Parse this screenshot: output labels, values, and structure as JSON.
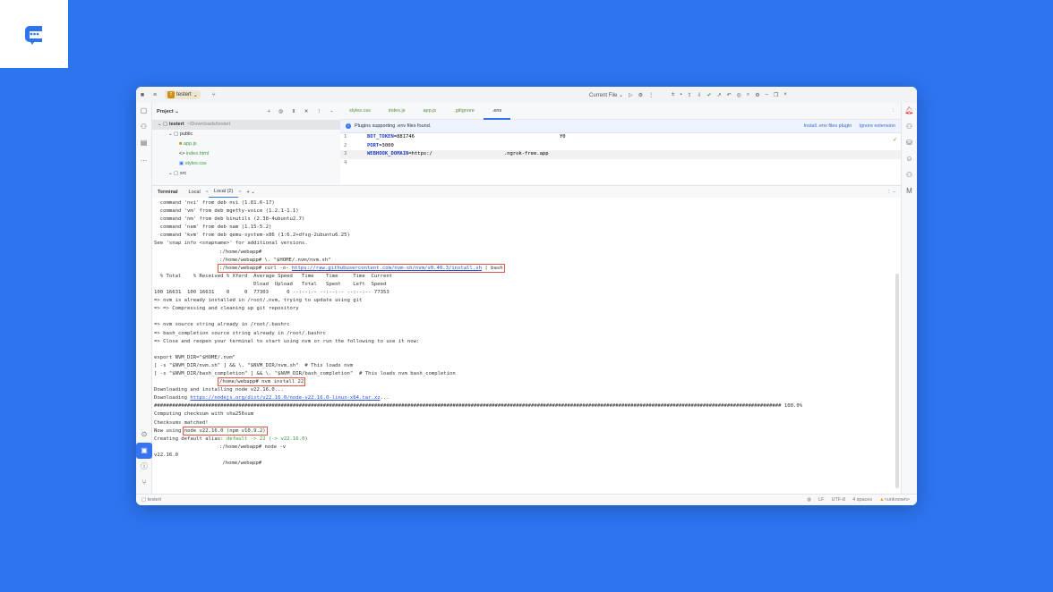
{
  "colors": {
    "background": "#2d74f0",
    "accent": "#3574f0",
    "highlight_box": "#e0574a"
  },
  "titlebar": {
    "project_badge": "T",
    "project_name": "testert",
    "run_config": "Current File"
  },
  "project_panel": {
    "title": "Project",
    "tree": [
      {
        "label": "testert",
        "extra": "~/Downloads/testert",
        "level": 0,
        "type": "folder"
      },
      {
        "label": "public",
        "level": 1,
        "type": "folder"
      },
      {
        "label": "app.js",
        "level": 2,
        "type": "js"
      },
      {
        "label": "index.html",
        "level": 2,
        "type": "html"
      },
      {
        "label": "styles.css",
        "level": 2,
        "type": "css"
      },
      {
        "label": "src",
        "level": 1,
        "type": "folder"
      }
    ]
  },
  "editor": {
    "tabs": [
      "styles.css",
      "index.js",
      "app.js",
      ".gitignore",
      ".env"
    ],
    "active_tab": ".env",
    "banner": {
      "text": "Plugins supporting .env files found.",
      "install": "Install .env files plugin",
      "ignore": "Ignore extension"
    },
    "lines": [
      {
        "n": "1",
        "key": "BOT_TOKEN",
        "val": "=881746",
        "tail": "Y0"
      },
      {
        "n": "2",
        "key": "PORT",
        "val": "=3000",
        "tail": ""
      },
      {
        "n": "3",
        "key": "WEBHOOK_DOMAIN",
        "val": "=https:/",
        "tail": ".ngrok-free.app"
      },
      {
        "n": "4",
        "key": "",
        "val": "",
        "tail": ""
      }
    ]
  },
  "terminal": {
    "tabs": [
      "Terminal",
      "Local",
      "Local (2)"
    ],
    "lines": [
      [
        {
          "t": "  command 'nvi' from deb nvi (1.81.6-17)"
        }
      ],
      [
        {
          "t": "  command 'vm' from deb mgetty-voice (1.2.1-1.1)"
        }
      ],
      [
        {
          "t": "  command 'nm' from deb binutils (2.38-4ubuntu2.7)"
        }
      ],
      [
        {
          "t": "  command 'nam' from deb nam (1.15-5.2)"
        }
      ],
      [
        {
          "t": "  command 'kvm' from deb qemu-system-x86 (1:6.2+dfsg-2ubuntu6.25)"
        }
      ],
      [
        {
          "t": "See 'snap info <snapname>' for additional versions."
        }
      ],
      [
        {
          "ind": true
        },
        {
          "t": ":/home/webapp#"
        }
      ],
      [
        {
          "ind": true
        },
        {
          "t": ":/home/webapp# \\. \"$HOME/.nvm/nvm.sh\""
        }
      ],
      [
        {
          "ind": true
        },
        {
          "box": true,
          "parts": [
            {
              "t": ":/home/webapp# curl -o- "
            },
            {
              "t": "https://raw.githubusercontent.com/nvm-sh/nvm/v0.40.3/install.sh",
              "c": "link"
            },
            {
              "t": " | bash"
            }
          ]
        }
      ],
      [
        {
          "t": "  % Total    % Received % Xferd  Average Speed   Time    Time     Time  Current"
        }
      ],
      [
        {
          "t": "                                 Dload  Upload   Total   Spent    Left  Speed"
        }
      ],
      [
        {
          "t": "100 16631  100 16631    0     0  77303      0 --:--:-- --:--:-- --:--:-- 77353"
        }
      ],
      [
        {
          "t": "=> nvm is already installed in /root/.nvm, trying to update using git"
        }
      ],
      [
        {
          "t": "=> => Compressing and cleaning up git repository"
        }
      ],
      [
        {
          "t": ""
        }
      ],
      [
        {
          "t": "=> nvm source string already in /root/.bashrc"
        }
      ],
      [
        {
          "t": "=> bash_completion source string already in /root/.bashrc"
        }
      ],
      [
        {
          "t": "=> Close and reopen your terminal to start using nvm or run the following to use it now:"
        }
      ],
      [
        {
          "t": ""
        }
      ],
      [
        {
          "t": "export NVM_DIR=\"$HOME/.nvm\""
        }
      ],
      [
        {
          "t": "[ -s \"$NVM_DIR/nvm.sh\" ] && \\. \"$NVM_DIR/nvm.sh\"  # This loads nvm"
        }
      ],
      [
        {
          "t": "[ -s \"$NVM_DIR/bash_completion\" ] && \\. \"$NVM_DIR/bash_completion\"  # This loads nvm bash_completion"
        }
      ],
      [
        {
          "ind": true
        },
        {
          "box": true,
          "parts": [
            {
              "t": "/home/webapp# nvm install 22"
            }
          ]
        }
      ],
      [
        {
          "t": "Downloading and installing node v22.16.0..."
        }
      ],
      [
        {
          "t": "Downloading "
        },
        {
          "t": "https://nodejs.org/dist/v22.16.0/node-v22.16.0-linux-x64.tar.xz",
          "c": "link"
        },
        {
          "t": "..."
        }
      ],
      [
        {
          "t": "################################################################################################################################################################################################################ 100.0%"
        }
      ],
      [
        {
          "t": "Computing checksum with sha256sum"
        }
      ],
      [
        {
          "t": "Checksums matched!"
        }
      ],
      [
        {
          "t": "Now using "
        },
        {
          "box": true,
          "parts": [
            {
              "t": "node v22.16.0 (npm v10.9.2)"
            }
          ]
        }
      ],
      [
        {
          "t": "Creating default alias: "
        },
        {
          "t": "default -> 22 (-> v22.16.0",
          "c": "grn"
        },
        {
          "t": ")"
        }
      ],
      [
        {
          "ind": true
        },
        {
          "t": ":/home/webapp# node -v"
        }
      ],
      [
        {
          "t": "v22.16.0"
        }
      ],
      [
        {
          "ind": true
        },
        {
          "t": " /home/webapp#"
        }
      ]
    ]
  },
  "status": {
    "project": "testert",
    "line_sep": "LF",
    "encoding": "UTF-8",
    "indent": "4 spaces",
    "warning": "<unknown>"
  }
}
